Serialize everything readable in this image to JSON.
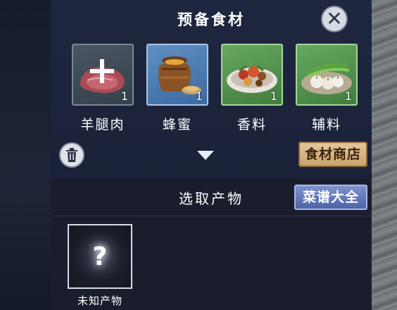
{
  "dialog": {
    "title": "预备食材",
    "close_icon": "close-icon"
  },
  "ingredients": [
    {
      "label": "羊腿肉",
      "quantity": "1",
      "icon": "raw-meat-icon",
      "add_icon": "plus-icon",
      "frame_color": "#3d4a55"
    },
    {
      "label": "蜂蜜",
      "quantity": "1",
      "icon": "honey-jar-icon",
      "frame_color": "#4f7fb6"
    },
    {
      "label": "香料",
      "quantity": "1",
      "icon": "spice-plate-icon",
      "frame_color": "#56944f"
    },
    {
      "label": "辅料",
      "quantity": "1",
      "icon": "scallion-garlic-plate-icon",
      "frame_color": "#56944f"
    }
  ],
  "toolbar": {
    "trash_icon": "trash-icon",
    "expand_icon": "chevron-down-icon",
    "shop_label": "食材商店"
  },
  "product_section": {
    "title": "选取产物",
    "recipe_label": "菜谱大全",
    "product": {
      "label": "未知产物",
      "symbol": "?",
      "icon": "unknown-product-icon"
    }
  },
  "colors": {
    "shop_button": "#d6b582",
    "recipe_button": "#6178bd",
    "panel": "#1d2540"
  }
}
